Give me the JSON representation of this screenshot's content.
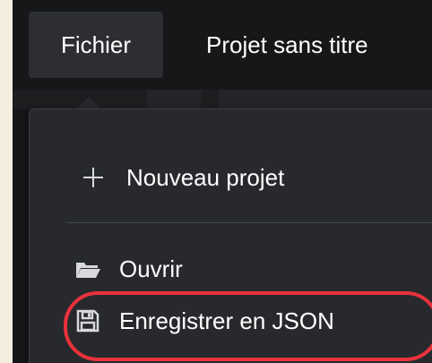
{
  "menubar": {
    "file_menu_label": "Fichier",
    "project_title": "Projet sans titre"
  },
  "file_menu": {
    "items": [
      {
        "label": "Nouveau projet",
        "icon": "plus-icon"
      },
      {
        "label": "Ouvrir",
        "icon": "folder-icon"
      },
      {
        "label": "Enregistrer en JSON",
        "icon": "save-icon"
      }
    ]
  },
  "colors": {
    "background": "#161718",
    "menu_background": "#27292c",
    "highlight": "#e8323c",
    "text": "#ffffff"
  }
}
